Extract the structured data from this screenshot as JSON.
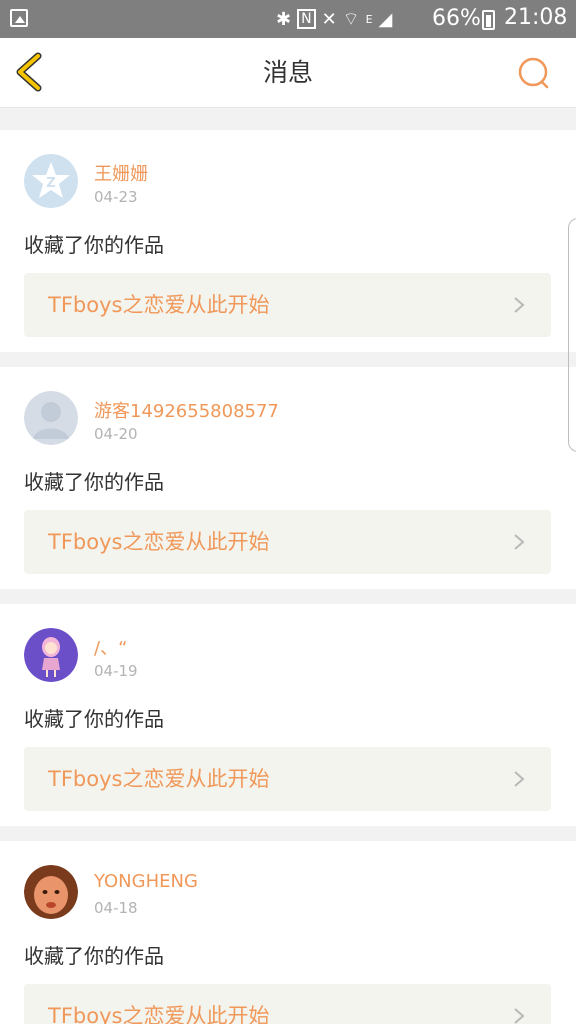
{
  "status_bar": {
    "battery": "66%",
    "time": "21:08",
    "icons": [
      "gallery-icon",
      "bluetooth-icon",
      "nfc-icon",
      "mute-icon",
      "wifi-icon",
      "signal-icon",
      "battery-icon"
    ],
    "network_type": "E"
  },
  "header": {
    "title": "消息",
    "back_icon": "chevron-left-icon",
    "search_icon": "search-icon"
  },
  "colors": {
    "accent": "#f0985a",
    "back_yellow": "#f5c400",
    "link_bg": "#f4f4ee",
    "divider": "#f2f2f2"
  },
  "messages": [
    {
      "user": "王姗姗",
      "date": "04-23",
      "action": "收藏了你的作品",
      "work": "TFboys之恋爱从此开始",
      "avatar": "qq-default-avatar"
    },
    {
      "user": "游客1492655808577",
      "date": "04-20",
      "action": "收藏了你的作品",
      "work": "TFboys之恋爱从此开始",
      "avatar": "guest-avatar"
    },
    {
      "user": "/、“",
      "date": "04-19",
      "action": "收藏了你的作品",
      "work": "TFboys之恋爱从此开始",
      "avatar": "anime-girl-avatar"
    },
    {
      "user": "YONGHENG",
      "date": "04-18",
      "action": "收藏了你的作品",
      "work": "TFboys之恋爱从此开始",
      "avatar": "photo-avatar"
    }
  ]
}
